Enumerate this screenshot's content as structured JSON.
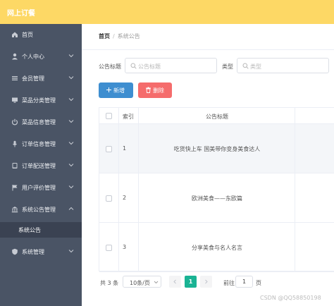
{
  "app": {
    "title": "网上订餐"
  },
  "colors": {
    "topbar": "#fdd865",
    "sidebar": "#4a5465",
    "primary": "#3e8ed0",
    "danger": "#f56c6c",
    "page_active": "#1ab394"
  },
  "sidebar": {
    "items": [
      {
        "label": "首页",
        "icon": "home-icon"
      },
      {
        "label": "个人中心",
        "icon": "user-icon"
      },
      {
        "label": "会员管理",
        "icon": "list-icon"
      },
      {
        "label": "菜品分类管理",
        "icon": "monitor-icon"
      },
      {
        "label": "菜品信息管理",
        "icon": "power-icon"
      },
      {
        "label": "订单信息管理",
        "icon": "microphone-icon"
      },
      {
        "label": "订单配送管理",
        "icon": "tablet-icon"
      },
      {
        "label": "用户评价管理",
        "icon": "flag-icon"
      },
      {
        "label": "系统公告管理",
        "icon": "bank-icon"
      },
      {
        "label": "系统公告"
      },
      {
        "label": "系统管理",
        "icon": "shield-icon"
      }
    ]
  },
  "breadcrumb": {
    "home": "首页",
    "separator": "/",
    "current": "系统公告"
  },
  "filters": {
    "title_label": "公告标题",
    "title_placeholder": "公告标题",
    "type_label": "类型",
    "type_placeholder": "类型"
  },
  "toolbar": {
    "add_label": "新增",
    "delete_label": "删除"
  },
  "table": {
    "headers": {
      "index": "索引",
      "title": "公告标题"
    },
    "rows": [
      {
        "index": "1",
        "title": "吃货快上车 国美带你变身美食达人"
      },
      {
        "index": "2",
        "title": "欧洲美食——东欧篇"
      },
      {
        "index": "3",
        "title": "分享美食与名人名言"
      }
    ]
  },
  "pagination": {
    "total_text": "共 3 条",
    "page_size": "10条/页",
    "current_page": "1",
    "goto_prefix": "前往",
    "goto_value": "1",
    "goto_suffix": "页"
  },
  "watermark": "CSDN @QQ58850198"
}
